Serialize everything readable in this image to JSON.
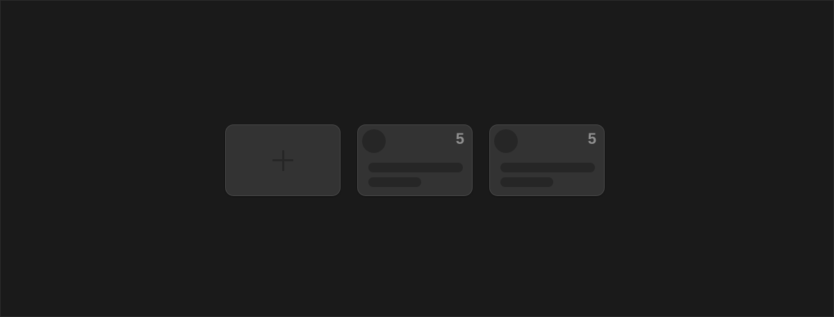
{
  "add_card": {
    "icon": "plus-icon"
  },
  "cards": [
    {
      "count": "5"
    },
    {
      "count": "5"
    }
  ],
  "colors": {
    "background": "#1a1a1a",
    "card": "#333333",
    "placeholder": "#262626",
    "count_text": "#8f8f8f"
  }
}
